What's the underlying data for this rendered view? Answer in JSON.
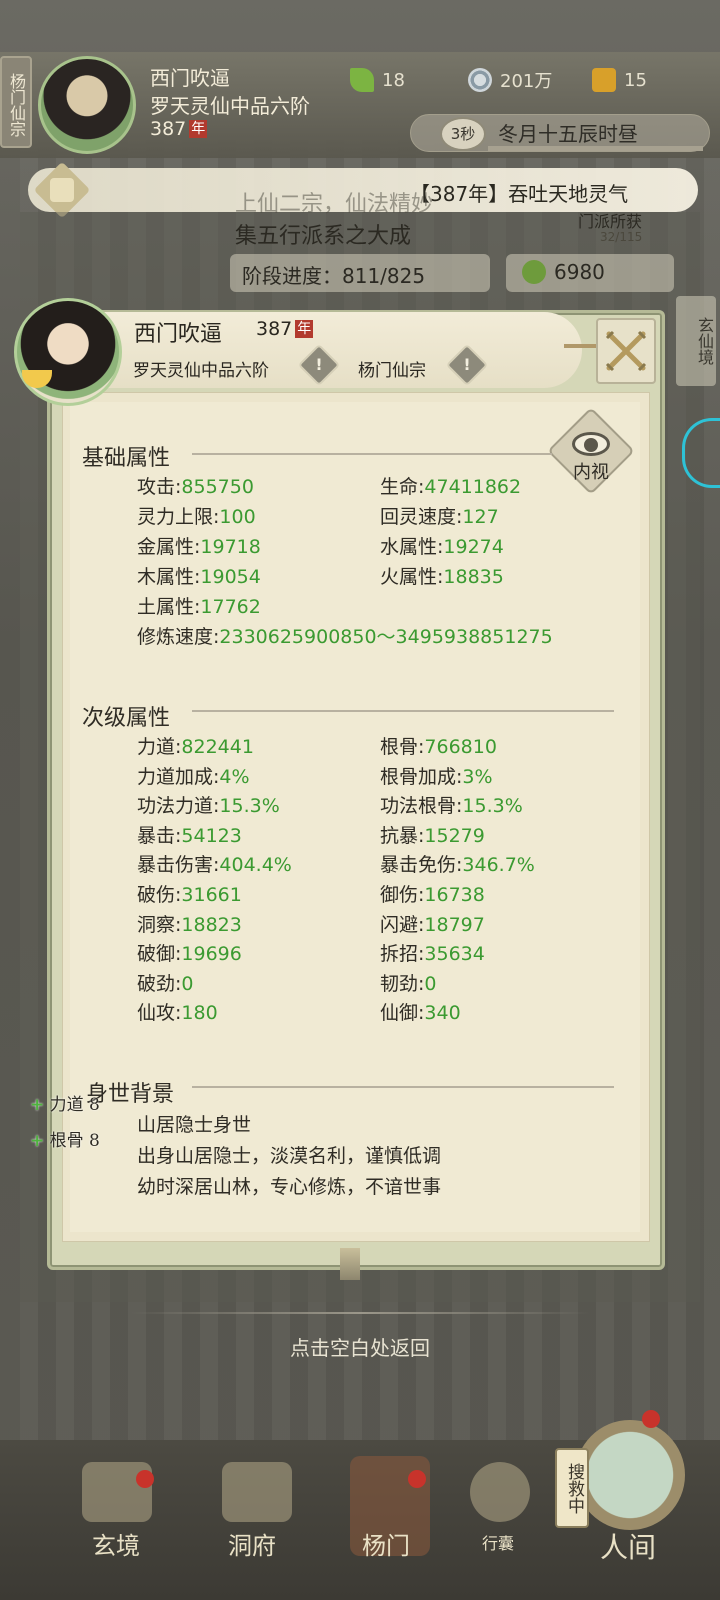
{
  "header": {
    "sect_tag": "杨门仙宗",
    "name": "西门吹逼",
    "realm": "罗天灵仙中品六阶",
    "age": "387",
    "age_unit": "年",
    "resources": {
      "leaf": "18",
      "coins": "201万",
      "gold": "15"
    },
    "timer": {
      "seconds": "3秒",
      "date": "冬月十五辰时昼"
    }
  },
  "ticker": {
    "text": "【387年】吞吐天地灵气"
  },
  "background": {
    "line1": "上仙二宗，仙法精妙",
    "line2": "集五行派系之大成",
    "progress_label": "阶段进度：811/825",
    "value": "6980",
    "guild_label": "门派所获",
    "guild_count": "32/115",
    "side_label": "玄仙境"
  },
  "modal": {
    "name": "西门吹逼",
    "age": "387",
    "age_unit": "年",
    "realm": "罗天灵仙中品六阶",
    "sect": "杨门仙宗",
    "insight_label": "内视",
    "basic": {
      "title": "基础属性",
      "items": [
        {
          "label": "攻击:",
          "value": "855750"
        },
        {
          "label": "生命:",
          "value": "47411862"
        },
        {
          "label": "灵力上限:",
          "value": "100"
        },
        {
          "label": "回灵速度:",
          "value": "127"
        },
        {
          "label": "金属性:",
          "value": "19718"
        },
        {
          "label": "水属性:",
          "value": "19274"
        },
        {
          "label": "木属性:",
          "value": "19054"
        },
        {
          "label": "火属性:",
          "value": "18835"
        },
        {
          "label": "土属性:",
          "value": "17762"
        }
      ],
      "speed": {
        "label": "修炼速度:",
        "value": "2330625900850～3495938851275"
      }
    },
    "secondary": {
      "title": "次级属性",
      "items": [
        {
          "label": "力道:",
          "value": "822441"
        },
        {
          "label": "根骨:",
          "value": "766810"
        },
        {
          "label": "力道加成:",
          "value": "4%"
        },
        {
          "label": "根骨加成:",
          "value": "3%"
        },
        {
          "label": "功法力道:",
          "value": "15.3%"
        },
        {
          "label": "功法根骨:",
          "value": "15.3%"
        },
        {
          "label": "暴击:",
          "value": "54123"
        },
        {
          "label": "抗暴:",
          "value": "15279"
        },
        {
          "label": "暴击伤害:",
          "value": "404.4%"
        },
        {
          "label": "暴击免伤:",
          "value": "346.7%"
        },
        {
          "label": "破伤:",
          "value": "31661"
        },
        {
          "label": "御伤:",
          "value": "16738"
        },
        {
          "label": "洞察:",
          "value": "18823"
        },
        {
          "label": "闪避:",
          "value": "18797"
        },
        {
          "label": "破御:",
          "value": "19696"
        },
        {
          "label": "拆招:",
          "value": "35634"
        },
        {
          "label": "破劲:",
          "value": "0"
        },
        {
          "label": "韧劲:",
          "value": "0"
        },
        {
          "label": "仙攻:",
          "value": "180"
        },
        {
          "label": "仙御:",
          "value": "340"
        }
      ]
    },
    "background_story": {
      "title": "身世背景",
      "lines": [
        "山居隐士身世",
        "出身山居隐士，淡漠名利，谨慎低调",
        "幼时深居山林，专心修炼，不谙世事"
      ]
    },
    "bonuses": [
      "力道 8",
      "根骨 8"
    ]
  },
  "hint": "点击空白处返回",
  "nav": {
    "items": [
      "玄境",
      "洞府",
      "杨门",
      "行囊",
      "人间"
    ],
    "search": "搜救中"
  }
}
